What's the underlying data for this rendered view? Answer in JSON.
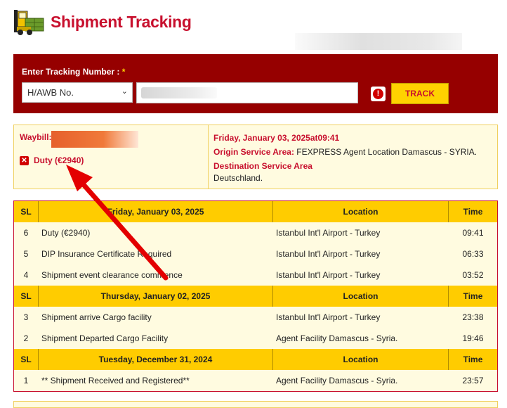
{
  "header": {
    "title": "Shipment Tracking",
    "icon": "forklift-icon"
  },
  "search": {
    "label": "Enter Tracking Number :",
    "required_mark": "*",
    "select_value": "H/AWB No.",
    "track_label": "TRACK"
  },
  "summary": {
    "waybill_label": "Waybill:",
    "duty_text": "Duty (€2940)",
    "date_line": "Friday, January 03, 2025at09:41",
    "origin_label": "Origin Service Area:",
    "origin_value": "FEXPRESS Agent Location Damascus - SYRIA.",
    "dest_label": "Destination Service Area",
    "dest_value_cont": "Deutschland."
  },
  "table": {
    "col_sl": "SL",
    "col_location": "Location",
    "col_time": "Time",
    "groups": [
      {
        "date": "Friday, January 03, 2025",
        "rows": [
          {
            "sl": "6",
            "event": "Duty (€2940)",
            "location": "Istanbul Int'l Airport - Turkey",
            "time": "09:41"
          },
          {
            "sl": "5",
            "event": "DIP Insurance Certificate Required",
            "location": "Istanbul Int'l Airport - Turkey",
            "time": "06:33"
          },
          {
            "sl": "4",
            "event": "Shipment event clearance commence",
            "location": "Istanbul Int'l Airport - Turkey",
            "time": "03:52"
          }
        ]
      },
      {
        "date": "Thursday, January 02, 2025",
        "rows": [
          {
            "sl": "3",
            "event": "Shipment arrive Cargo facility",
            "location": "Istanbul Int'l Airport - Turkey",
            "time": "23:38"
          },
          {
            "sl": "2",
            "event": "Shipment Departed Cargo Facility",
            "location": "Agent Facility Damascus - Syria.",
            "time": "19:46"
          }
        ]
      },
      {
        "date": "Tuesday, December 31, 2024",
        "rows": [
          {
            "sl": "1",
            "event": "** Shipment Received and Registered**",
            "location": "Agent Facility Damascus - Syria.",
            "time": "23:57"
          }
        ]
      }
    ]
  },
  "colors": {
    "brand_red": "#c8102e",
    "panel_red": "#960000",
    "yellow": "#ffcc00",
    "cream": "#fffbe0"
  }
}
